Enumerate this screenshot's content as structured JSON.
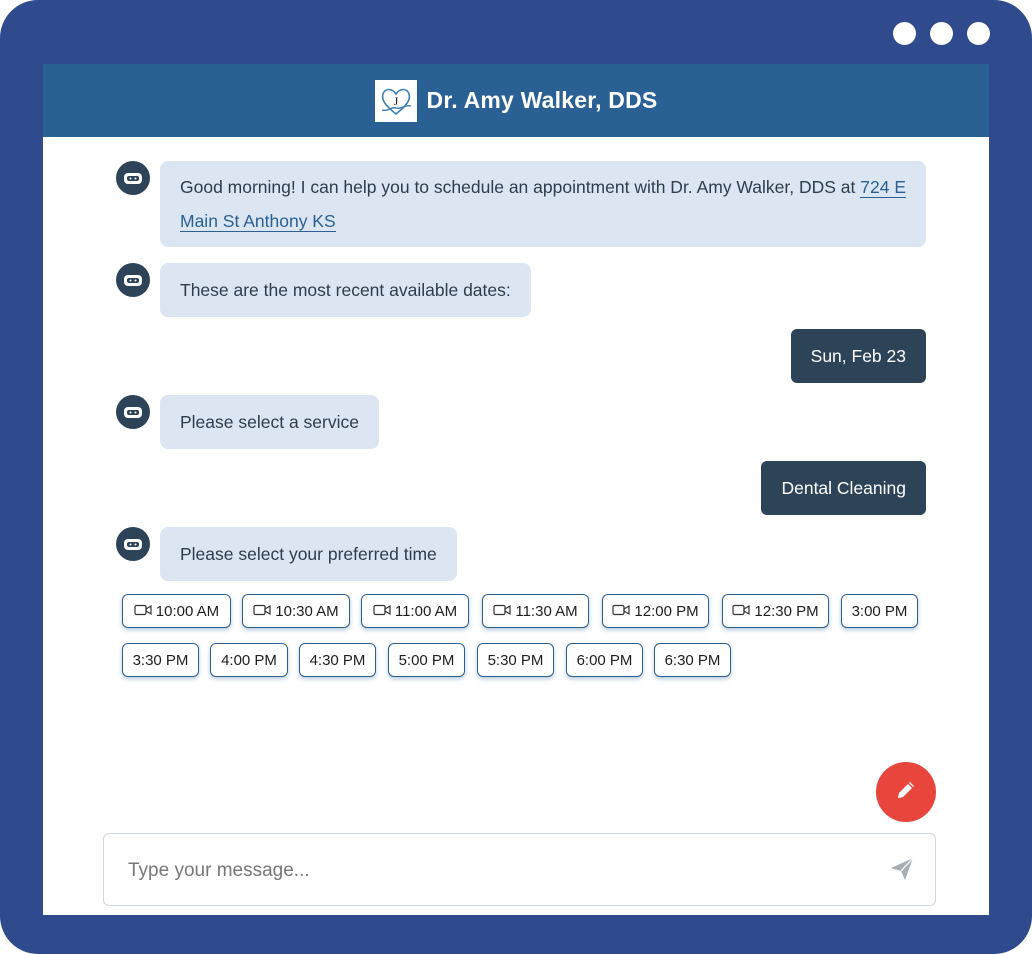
{
  "window": {
    "title": "Dr. Amy Walker, DDS"
  },
  "colors": {
    "frame": "#2f4b8d",
    "header": "#2b6095",
    "bot_bubble": "#dbe6f2",
    "user_bubble": "#2d4357",
    "fab": "#e8453c"
  },
  "messages": {
    "greeting_text": "Good morning! I can help you to schedule an appointment with Dr. Amy Walker, DDS at ",
    "greeting_link": "724 E Main St Anthony KS",
    "dates_prompt": "These are the most recent available dates:",
    "selected_date": "Sun, Feb 23",
    "service_prompt": "Please select a service",
    "selected_service": "Dental Cleaning",
    "time_prompt": "Please select your preferred time"
  },
  "time_slots": [
    {
      "label": "10:00 AM",
      "icon": "video-camera-icon"
    },
    {
      "label": "10:30 AM",
      "icon": "video-camera-icon"
    },
    {
      "label": "11:00 AM",
      "icon": "video-camera-icon"
    },
    {
      "label": "11:30 AM",
      "icon": "video-camera-icon"
    },
    {
      "label": "12:00 PM",
      "icon": "video-camera-icon"
    },
    {
      "label": "12:30 PM",
      "icon": "video-camera-icon"
    },
    {
      "label": "3:00 PM"
    },
    {
      "label": "3:30 PM"
    },
    {
      "label": "4:00 PM"
    },
    {
      "label": "4:30 PM"
    },
    {
      "label": "5:00 PM"
    },
    {
      "label": "5:30 PM"
    },
    {
      "label": "6:00 PM"
    },
    {
      "label": "6:30 PM"
    }
  ],
  "composer": {
    "placeholder": "Type your message..."
  },
  "icons": {
    "fab": "pencil-icon",
    "send": "send-icon",
    "avatar": "bot-icon",
    "logo": "heart-tooth-logo"
  }
}
